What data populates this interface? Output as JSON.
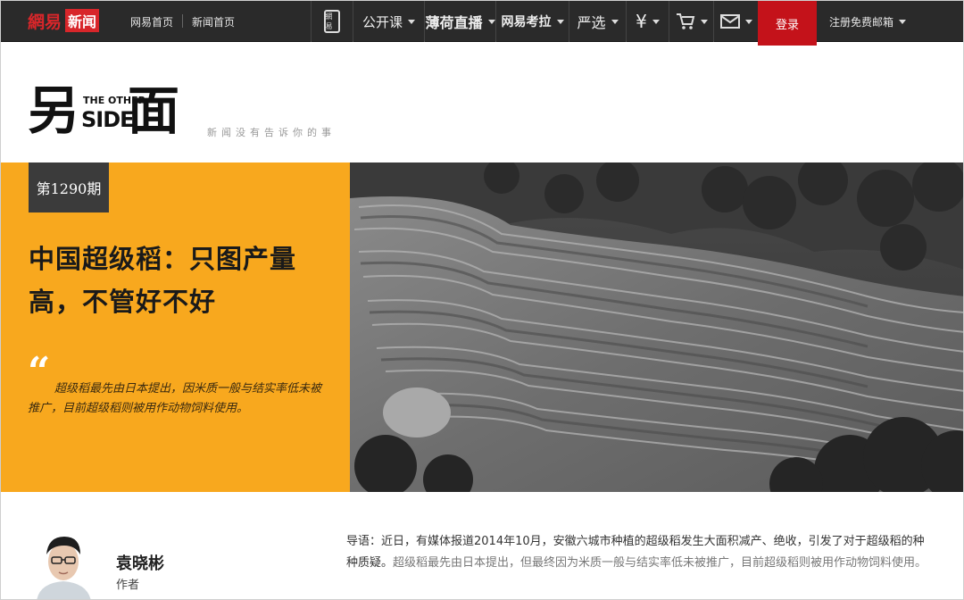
{
  "topbar": {
    "brand": {
      "part1": "網易",
      "part2": "新闻"
    },
    "links": [
      "网易首页",
      "新闻首页"
    ],
    "nav": {
      "app_label": "網易",
      "open_course": "公开课",
      "mint_live": "薄荷直播",
      "kaola": "网易考拉",
      "yanxuan": "严选",
      "yen": "¥"
    },
    "login": "登录",
    "register": "注册免费邮箱"
  },
  "column": {
    "slogan": "新闻没有告诉你的事",
    "logo": {
      "char1": "另",
      "small_top": "THE OTHER",
      "small_bottom": "SIDE",
      "char2": "面"
    }
  },
  "hero": {
    "issue": "第1290期",
    "headline_line1": "中国超级稻：只图产量",
    "headline_line2": "高，不管好不好",
    "quote_mark": "“",
    "quote": "超级稻最先由日本提出，因米质一般与结实率低未被推广，目前超级稻则被用作动物饲料使用。"
  },
  "author": {
    "name": "袁晓彬",
    "role": "作者"
  },
  "intro": {
    "lead": "导语：近日，有媒体报道2014年10月，安徽六城市种植的超级稻发生大面积减产、绝收，引发了对于超级稻的种种质疑。",
    "rest": "超级稻最先由日本提出，但最终因为米质一般与结实率低未被推广，目前超级稻则被用作动物饲料使用。"
  },
  "colors": {
    "topbar": "#2a2a2a",
    "login": "#c4121a",
    "hero_panel": "#f8a81e",
    "issue_bg": "#3b3b3b",
    "brand_red": "#d8262a"
  }
}
